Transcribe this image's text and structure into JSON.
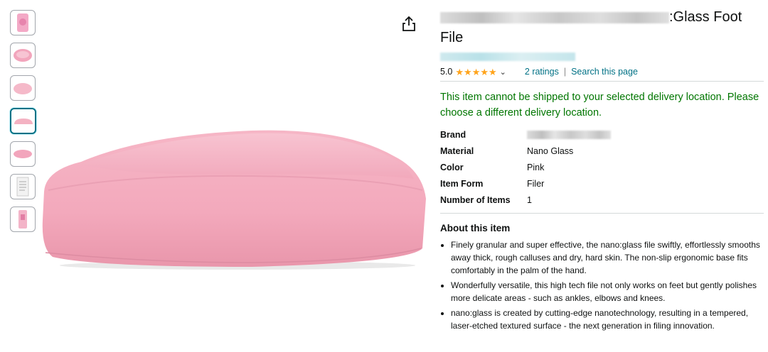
{
  "product": {
    "title_visible": ":Glass Foot File",
    "title_line2": "File",
    "title_line1_suffix": ":Glass Foot",
    "rating_value": "5.0",
    "stars": 5,
    "ratings_link": "2 ratings",
    "separator": "|",
    "search_link": "Search this page",
    "shipping_message": "This item cannot be shipped to your selected delivery location. Please choose a different delivery location."
  },
  "specs": [
    {
      "key": "Brand",
      "value": ""
    },
    {
      "key": "Material",
      "value": "Nano Glass"
    },
    {
      "key": "Color",
      "value": "Pink"
    },
    {
      "key": "Item Form",
      "value": "Filer"
    },
    {
      "key": "Number of Items",
      "value": "1"
    }
  ],
  "about": {
    "title": "About this item",
    "bullets": [
      "Finely granular and super effective, the nano:glass file swiftly, effortlessly smooths away thick, rough calluses and dry, hard skin. The non-slip ergonomic base fits comfortably in the palm of the hand.",
      "Wonderfully versatile, this high tech file not only works on feet but gently polishes more delicate areas - such as ankles, elbows and knees.",
      "nano:glass is created by cutting-edge nanotechnology, resulting in a tempered, laser-etched textured surface - the next generation in filing innovation."
    ]
  },
  "colors": {
    "accent_link": "#007185",
    "shipping_green": "#007600",
    "star_orange": "#ffa41c",
    "product_pink": "#f4b2c2"
  },
  "icons": {
    "share": "share-icon",
    "chevron": "chevron-down-icon",
    "star": "star-icon"
  }
}
